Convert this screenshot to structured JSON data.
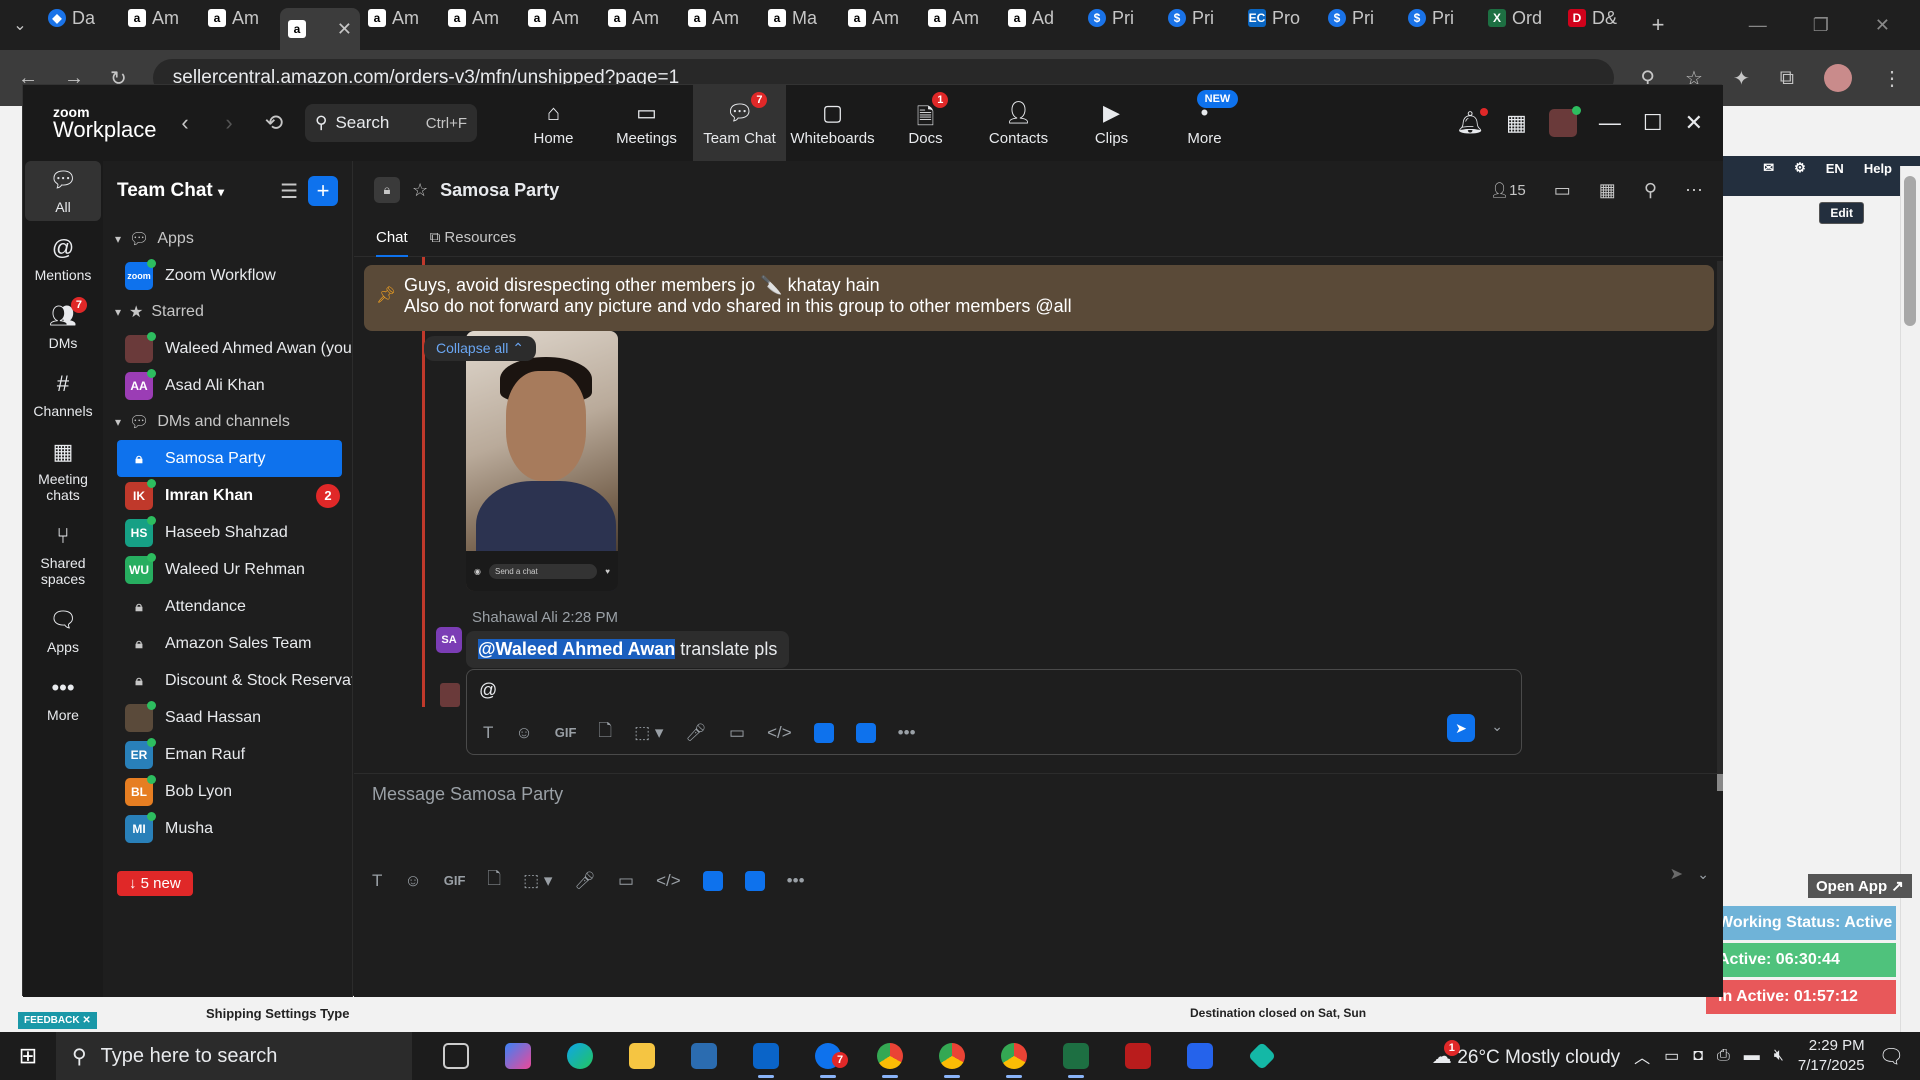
{
  "browser": {
    "tabs": [
      {
        "icon": "zoom-icon",
        "label": "Da"
      },
      {
        "icon": "amazon-icon",
        "label": "Am"
      },
      {
        "icon": "amazon-icon",
        "label": "Am"
      },
      {
        "icon": "amazon-icon",
        "label": ""
      },
      {
        "icon": "amazon-icon",
        "label": "Am"
      },
      {
        "icon": "amazon-icon",
        "label": "Am"
      },
      {
        "icon": "amazon-icon",
        "label": "Am"
      },
      {
        "icon": "amazon-icon",
        "label": "Am"
      },
      {
        "icon": "amazon-icon",
        "label": "Am"
      },
      {
        "icon": "amazon-icon",
        "label": "Ma"
      },
      {
        "icon": "amazon-icon",
        "label": "Am"
      },
      {
        "icon": "amazon-icon",
        "label": "Am"
      },
      {
        "icon": "amazon-icon",
        "label": "Ad"
      },
      {
        "icon": "s-icon",
        "label": "Pri"
      },
      {
        "icon": "s-icon",
        "label": "Pri"
      },
      {
        "icon": "ec-icon",
        "label": "Pro"
      },
      {
        "icon": "s-icon",
        "label": "Pri"
      },
      {
        "icon": "s-icon",
        "label": "Pri"
      },
      {
        "icon": "excel-icon",
        "label": "Ord"
      },
      {
        "icon": "d-icon",
        "label": "D&"
      }
    ],
    "url": "sellercentral.amazon.com/orders-v3/mfn/unshipped?page=1"
  },
  "seller": {
    "lang": "EN",
    "help": "Help",
    "edit": "Edit",
    "shipping_settings": "Shipping Settings Type",
    "destination_closed": "Destination closed on Sat, Sun",
    "feedback": "FEEDBACK"
  },
  "tracker": {
    "open_app": "Open App",
    "status": "Working Status: Active",
    "active": "Active: 06:30:44",
    "inactive": "In Active: 01:57:12"
  },
  "zoom": {
    "logo_top": "zoom",
    "logo_bottom": "Workplace",
    "search_label": "Search",
    "search_shortcut": "Ctrl+F",
    "nav": [
      {
        "label": "Home",
        "badge": ""
      },
      {
        "label": "Meetings",
        "badge": ""
      },
      {
        "label": "Team Chat",
        "badge": "7"
      },
      {
        "label": "Whiteboards",
        "badge": ""
      },
      {
        "label": "Docs",
        "badge": "1"
      },
      {
        "label": "Contacts",
        "badge": ""
      },
      {
        "label": "Clips",
        "badge": ""
      },
      {
        "label": "More",
        "badge": "NEW"
      }
    ],
    "rail": [
      {
        "label": "All",
        "badge": ""
      },
      {
        "label": "Mentions",
        "badge": ""
      },
      {
        "label": "DMs",
        "badge": "7"
      },
      {
        "label": "Channels",
        "badge": ""
      },
      {
        "label": "Meeting chats",
        "badge": ""
      },
      {
        "label": "Shared spaces",
        "badge": ""
      },
      {
        "label": "Apps",
        "badge": ""
      },
      {
        "label": "More",
        "badge": ""
      }
    ],
    "sidebar": {
      "title": "Team Chat",
      "sections": {
        "apps": "Apps",
        "starred": "Starred",
        "dms": "DMs and channels"
      },
      "apps": [
        {
          "initials": "zoom",
          "name": "Zoom Workflow",
          "color": "#0e72ed"
        }
      ],
      "starred": [
        {
          "initials": "",
          "name": "Waleed Ahmed Awan (you)",
          "color": "#6a3a3a"
        },
        {
          "initials": "AA",
          "name": "Asad Ali Khan",
          "color": "#9b3db5"
        }
      ],
      "channels": [
        {
          "initials": "",
          "name": "Samosa Party",
          "lock": true,
          "active": true
        },
        {
          "initials": "IK",
          "name": "Imran Khan",
          "color": "#c0392b",
          "unread": "2"
        },
        {
          "initials": "HS",
          "name": "Haseeb Shahzad",
          "color": "#16a085"
        },
        {
          "initials": "WU",
          "name": "Waleed Ur Rehman",
          "color": "#27ae60"
        },
        {
          "initials": "",
          "name": "Attendance",
          "lock": true
        },
        {
          "initials": "",
          "name": "Amazon Sales Team",
          "lock": true
        },
        {
          "initials": "",
          "name": "Discount & Stock Reservatio...",
          "lock": true
        },
        {
          "initials": "",
          "name": "Saad Hassan",
          "color": "#5a4a3a"
        },
        {
          "initials": "ER",
          "name": "Eman Rauf",
          "color": "#2980b9"
        },
        {
          "initials": "BL",
          "name": "Bob Lyon",
          "color": "#e67e22"
        },
        {
          "initials": "MI",
          "name": "Musha",
          "color": "#2980b9"
        }
      ],
      "new_pill": "↓ 5 new"
    },
    "chat": {
      "title": "Samosa Party",
      "member_count": "15",
      "tabs": [
        "Chat",
        "Resources"
      ],
      "pinned_line1": "Guys, avoid disrespecting other members jo 🔪 khatay hain",
      "pinned_line2": "Also do not forward any picture and vdo shared in this group to other members @all",
      "collapse_all": "Collapse all",
      "photo_input": "Send a chat",
      "msg_sender": "Shahawal Ali",
      "msg_time": "2:28 PM",
      "msg_avatar": "SA",
      "msg_mention": "@Waleed Ahmed Awan",
      "msg_text": " translate pls",
      "reply_text": "@",
      "compose_placeholder": "Message Samosa Party",
      "toolbar_gif": "GIF"
    }
  },
  "taskbar": {
    "search_placeholder": "Type here to search",
    "weather": "26°C  Mostly cloudy",
    "time": "2:29 PM",
    "date": "7/17/2025",
    "zoom_badge": "7",
    "weather_badge": "1"
  }
}
